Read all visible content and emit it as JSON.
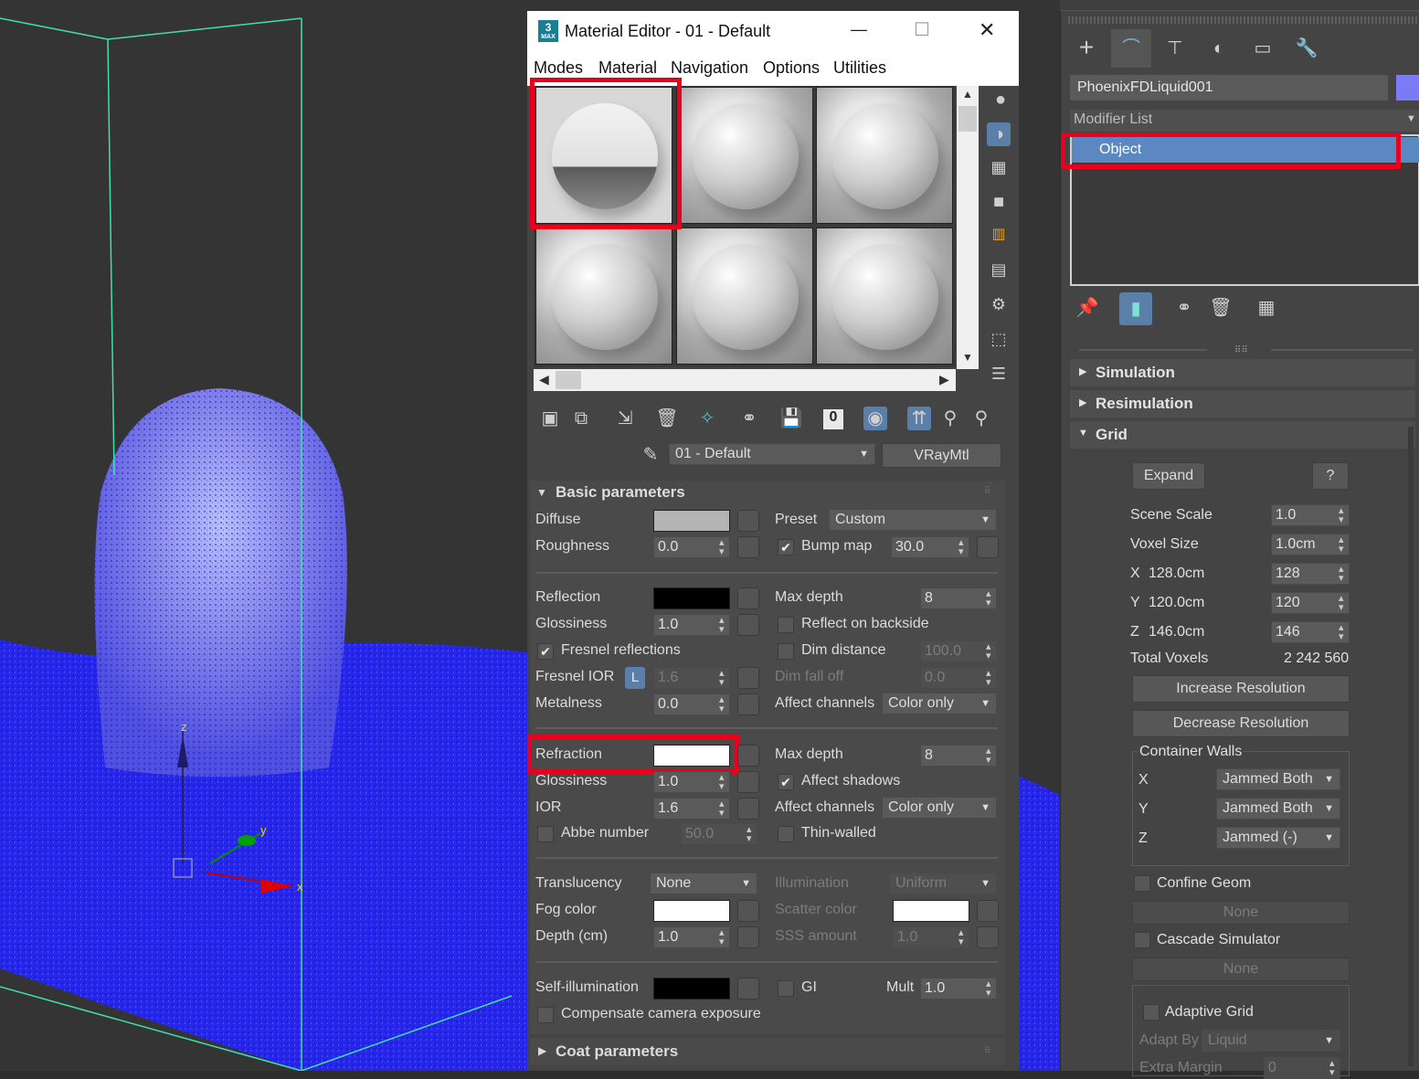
{
  "viewport": {
    "axis_x": "x",
    "axis_y": "y",
    "axis_z": "z",
    "colors": {
      "liquid": "#2b2be8",
      "liquid_light": "#8c8ce0",
      "grid_lines": "#3fe0b0"
    }
  },
  "material_editor": {
    "title": "Material Editor - 01 - Default",
    "window_controls": {
      "minimize": "—",
      "maximize": "☐",
      "close": "✕"
    },
    "menu": [
      "Modes",
      "Material",
      "Navigation",
      "Options",
      "Utilities"
    ],
    "material_name": "01 - Default",
    "material_type": "VRayMtl",
    "toolbar_zero": "0",
    "rollout_basic": "Basic parameters",
    "rollout_coat": "Coat parameters",
    "diffuse": {
      "label": "Diffuse",
      "color": "#b4b4b4"
    },
    "preset": {
      "label": "Preset",
      "value": "Custom"
    },
    "roughness": {
      "label": "Roughness",
      "value": "0.0"
    },
    "bump_map": {
      "label": "Bump map",
      "value": "30.0",
      "checked": "✔"
    },
    "reflection": {
      "label": "Reflection",
      "color": "#000000"
    },
    "refl_max_depth": {
      "label": "Max depth",
      "value": "8"
    },
    "refl_glossiness": {
      "label": "Glossiness",
      "value": "1.0"
    },
    "reflect_backside": "Reflect on backside",
    "fresnel_reflections": {
      "label": "Fresnel reflections",
      "checked": "✔"
    },
    "dim_distance": {
      "label": "Dim distance",
      "value": "100.0"
    },
    "fresnel_ior": {
      "label": "Fresnel IOR",
      "lock": "L",
      "value": "1.6"
    },
    "dim_fall_off": {
      "label": "Dim fall off",
      "value": "0.0"
    },
    "metalness": {
      "label": "Metalness",
      "value": "0.0"
    },
    "affect_channels_1": {
      "label": "Affect channels",
      "value": "Color only"
    },
    "refraction": {
      "label": "Refraction",
      "color": "#ffffff"
    },
    "refr_max_depth": {
      "label": "Max depth",
      "value": "8"
    },
    "refr_glossiness": {
      "label": "Glossiness",
      "value": "1.0"
    },
    "affect_shadows": {
      "label": "Affect shadows",
      "checked": "✔"
    },
    "ior": {
      "label": "IOR",
      "value": "1.6"
    },
    "affect_channels_2": {
      "label": "Affect channels",
      "value": "Color only"
    },
    "abbe": {
      "label": "Abbe number",
      "value": "50.0"
    },
    "thin_walled": "Thin-walled",
    "translucency": {
      "label": "Translucency",
      "value": "None"
    },
    "illumination": {
      "label": "Illumination",
      "value": "Uniform"
    },
    "fog_color": {
      "label": "Fog color",
      "color": "#ffffff"
    },
    "scatter_color": {
      "label": "Scatter color",
      "color": "#ffffff"
    },
    "depth": {
      "label": "Depth (cm)",
      "value": "1.0"
    },
    "sss_amount": {
      "label": "SSS amount",
      "value": "1.0"
    },
    "self_illum": {
      "label": "Self-illumination",
      "color": "#000000"
    },
    "gi": "GI",
    "mult": {
      "label": "Mult",
      "value": "1.0"
    },
    "compensate": "Compensate camera exposure"
  },
  "command_panel": {
    "object_name": "PhoenixFDLiquid001",
    "object_color": "#7b7bf5",
    "modifier_list": "Modifier List",
    "stack_item": "Object",
    "rollouts": {
      "simulation": "Simulation",
      "resimulation": "Resimulation",
      "grid": "Grid"
    },
    "expand": "Expand",
    "help": "?",
    "scene_scale": {
      "label": "Scene Scale",
      "value": "1.0"
    },
    "voxel_size": {
      "label": "Voxel Size",
      "value": "1.0cm"
    },
    "grid_x": {
      "axis": "X",
      "size": "128.0cm",
      "value": "128"
    },
    "grid_y": {
      "axis": "Y",
      "size": "120.0cm",
      "value": "120"
    },
    "grid_z": {
      "axis": "Z",
      "size": "146.0cm",
      "value": "146"
    },
    "total_voxels": {
      "label": "Total Voxels",
      "value": "2 242 560"
    },
    "increase_res": "Increase Resolution",
    "decrease_res": "Decrease Resolution",
    "container_walls": "Container Walls",
    "walls": [
      {
        "axis": "X",
        "value": "Jammed Both"
      },
      {
        "axis": "Y",
        "value": "Jammed Both"
      },
      {
        "axis": "Z",
        "value": "Jammed (-)"
      }
    ],
    "confine_geom": "Confine Geom",
    "none_1": "None",
    "cascade": "Cascade Simulator",
    "none_2": "None",
    "adaptive_grid": "Adaptive Grid",
    "adapt_by": {
      "label": "Adapt By",
      "value": "Liquid"
    },
    "extra_margin": {
      "label": "Extra Margin",
      "value": "0"
    }
  }
}
